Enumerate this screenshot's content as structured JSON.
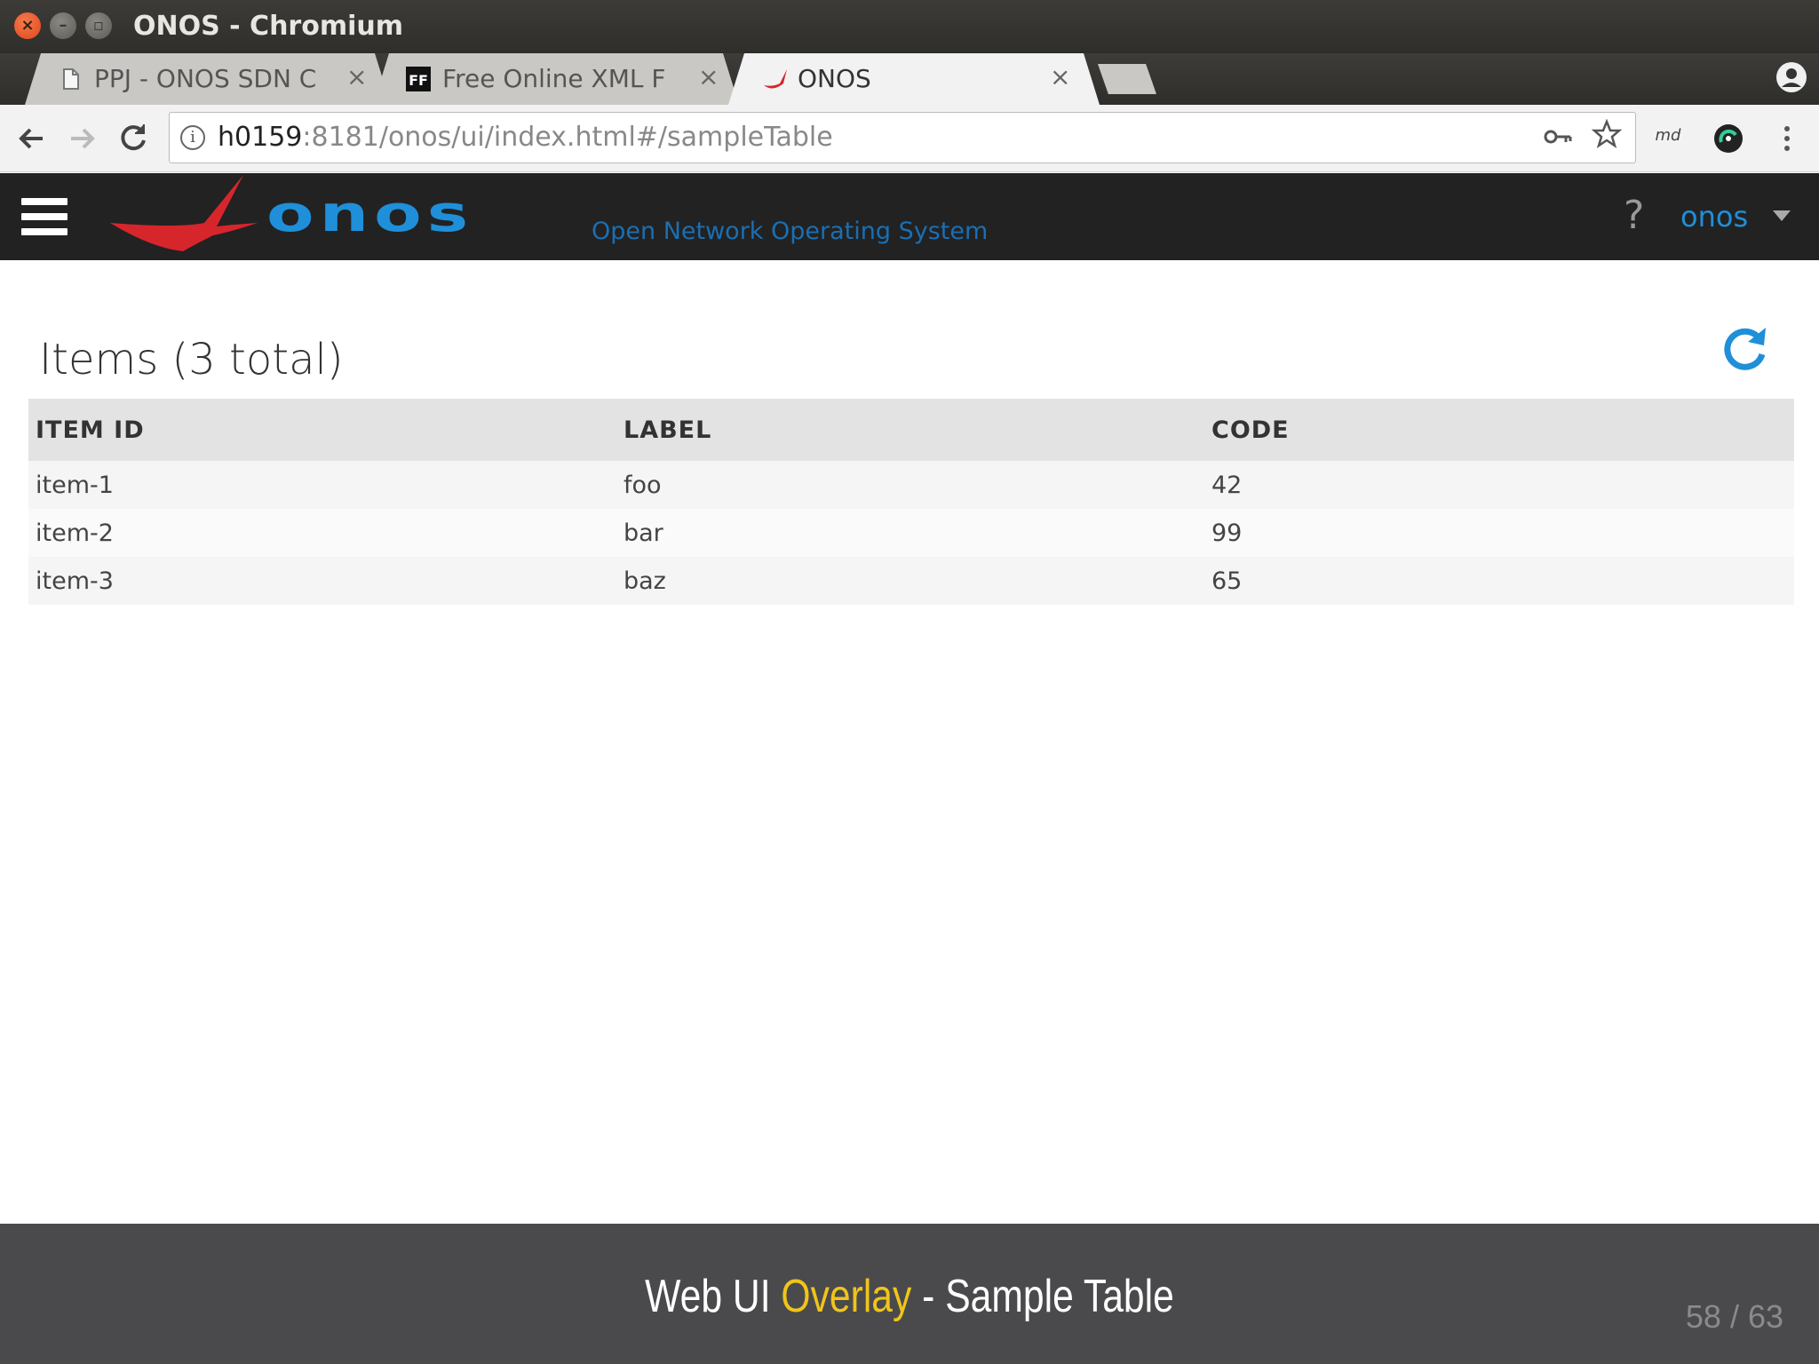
{
  "window": {
    "title": "ONOS - Chromium",
    "close_glyph": "×",
    "min_glyph": "–",
    "max_glyph": "▫"
  },
  "tabs": [
    {
      "label": "PPJ - ONOS SDN C",
      "icon": "document-icon",
      "active": false
    },
    {
      "label": "Free Online XML F",
      "icon": "ff-favicon",
      "active": false
    },
    {
      "label": "ONOS",
      "icon": "onos-favicon",
      "active": true
    }
  ],
  "tab_close_glyph": "×",
  "toolbar": {
    "url_host": "h0159",
    "url_rest": ":8181/onos/ui/index.html#/sampleTable",
    "ext_md_label": "md"
  },
  "onos_header": {
    "logo_text": "onos",
    "logo_subtitle": "Open Network Operating System",
    "help_glyph": "?",
    "user": "onos"
  },
  "content": {
    "title": "Items (3 total)",
    "columns": [
      "ITEM ID",
      "LABEL",
      "CODE"
    ],
    "rows": [
      [
        "item-1",
        "foo",
        "42"
      ],
      [
        "item-2",
        "bar",
        "99"
      ],
      [
        "item-3",
        "baz",
        "65"
      ]
    ]
  },
  "slide": {
    "title_pre": "Web UI ",
    "title_highlight": "Overlay",
    "title_post": " - Sample Table",
    "page_number": "58 / 63",
    "highlight_color": "#f0c419"
  },
  "colors": {
    "onos_blue": "#1f8fd9",
    "onos_red": "#d6262c",
    "header_bg": "#222222"
  }
}
